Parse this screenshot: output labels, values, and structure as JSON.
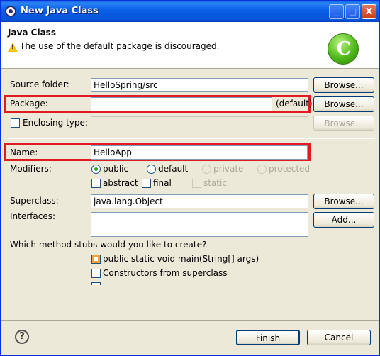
{
  "window": {
    "title": "New Java Class",
    "controls": {
      "minimize": "_",
      "maximize": "□",
      "close": "X"
    }
  },
  "header": {
    "title": "Java Class",
    "message": "The use of the default package is discouraged.",
    "logo_letter": "C"
  },
  "form": {
    "source_folder": {
      "label": "Source folder:",
      "value": "HelloSpring/src",
      "browse": "Browse..."
    },
    "package": {
      "label": "Package:",
      "value": "",
      "suffix": "(default)",
      "browse": "Browse..."
    },
    "enclosing_type": {
      "label": "Enclosing type:",
      "value": "",
      "browse": "Browse...",
      "checked": false
    },
    "name": {
      "label": "Name:",
      "value": "HelloApp"
    },
    "modifiers": {
      "label": "Modifiers:",
      "access": [
        {
          "label": "public",
          "checked": true,
          "enabled": true
        },
        {
          "label": "default",
          "checked": false,
          "enabled": true
        },
        {
          "label": "private",
          "checked": false,
          "enabled": false
        },
        {
          "label": "protected",
          "checked": false,
          "enabled": false
        }
      ],
      "flags": [
        {
          "label": "abstract",
          "checked": false,
          "enabled": true
        },
        {
          "label": "final",
          "checked": false,
          "enabled": true
        },
        {
          "label": "static",
          "checked": false,
          "enabled": false
        }
      ]
    },
    "superclass": {
      "label": "Superclass:",
      "value": "java.lang.Object",
      "browse": "Browse..."
    },
    "interfaces": {
      "label": "Interfaces:",
      "add": "Add..."
    },
    "stubs": {
      "question": "Which method stubs would you like to create?",
      "options": [
        {
          "label": "public static void main(String[] args)",
          "checked": true
        },
        {
          "label": "Constructors from superclass",
          "checked": false
        }
      ]
    }
  },
  "footer": {
    "help": "?",
    "finish": "Finish",
    "cancel": "Cancel"
  },
  "colors": {
    "highlight": "#e01b24",
    "titlebar": "#0553d8",
    "dialog_bg": "#ece9d8"
  }
}
